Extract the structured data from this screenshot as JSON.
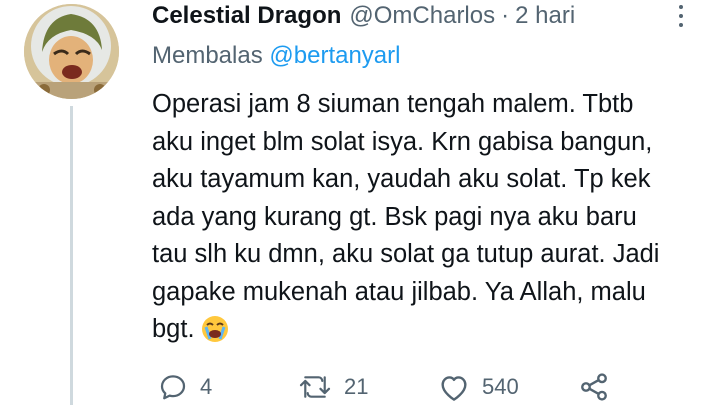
{
  "tweet": {
    "author_name": "Celestial Dragon",
    "author_handle": "@OmCharlos",
    "separator": "·",
    "time": "2 hari",
    "reply_prefix": "Membalas",
    "reply_to": "@bertanyarl",
    "text_lines": [
      "Operasi jam 8 siuman tengah malem. Tbtb",
      "aku inget blm solat isya. Krn gabisa bangun,",
      "aku tayamum kan, yaudah aku solat. Tp kek",
      "ada yang kurang gt. Bsk pagi nya aku baru",
      "tau slh ku dmn, aku solat ga tutup aurat. Jadi",
      "gapake mukenah atau jilbab. Ya Allah, malu",
      "bgt."
    ],
    "emoji_icon": "loudly-crying-face-emoji"
  },
  "actions": {
    "reply_count": "4",
    "retweet_count": "21",
    "like_count": "540",
    "share_icon": "share-icon"
  },
  "colors": {
    "text": "#0f1419",
    "secondary": "#536471",
    "link": "#1d9bf0",
    "thread_line": "#cfd9de"
  }
}
